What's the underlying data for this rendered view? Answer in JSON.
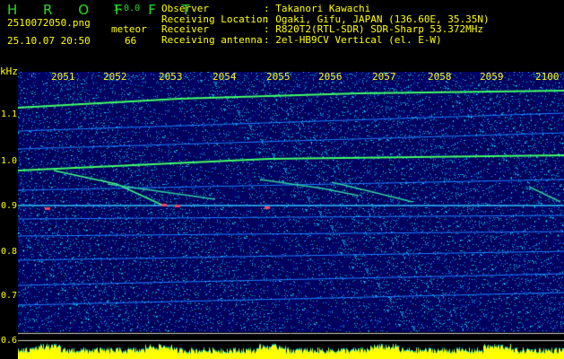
{
  "app": {
    "name": "H R O F F T",
    "version": "1.0.0"
  },
  "file": {
    "name": "2510072050.png",
    "datetime": "25.10.07 20:50"
  },
  "meteor": {
    "label": "meteor",
    "count": "66"
  },
  "info": [
    {
      "key": "Observer",
      "value": "Takanori Kawachi"
    },
    {
      "key": "Receiving Location",
      "value": "Ogaki, Gifu, JAPAN (136.60E, 35.35N)"
    },
    {
      "key": "Receiver",
      "value": "R820T2(RTL-SDR) SDR-Sharp 53.372MHz"
    },
    {
      "key": "Receiving antenna",
      "value": "2el-HB9CV Vertical (el. E-W)"
    }
  ],
  "axis": {
    "yunit": "kHz",
    "time_ticks": [
      "2051",
      "2052",
      "2053",
      "2054",
      "2055",
      "2056",
      "2057",
      "2058",
      "2059",
      "2100"
    ],
    "freq_ticks": [
      "1.1",
      "1.0",
      "0.9",
      "0.8",
      "0.7",
      "0.6"
    ]
  },
  "colors": {
    "text": "#ffff00",
    "title": "#22dd22",
    "background": "#000000",
    "noise": "#0a0a80"
  }
}
